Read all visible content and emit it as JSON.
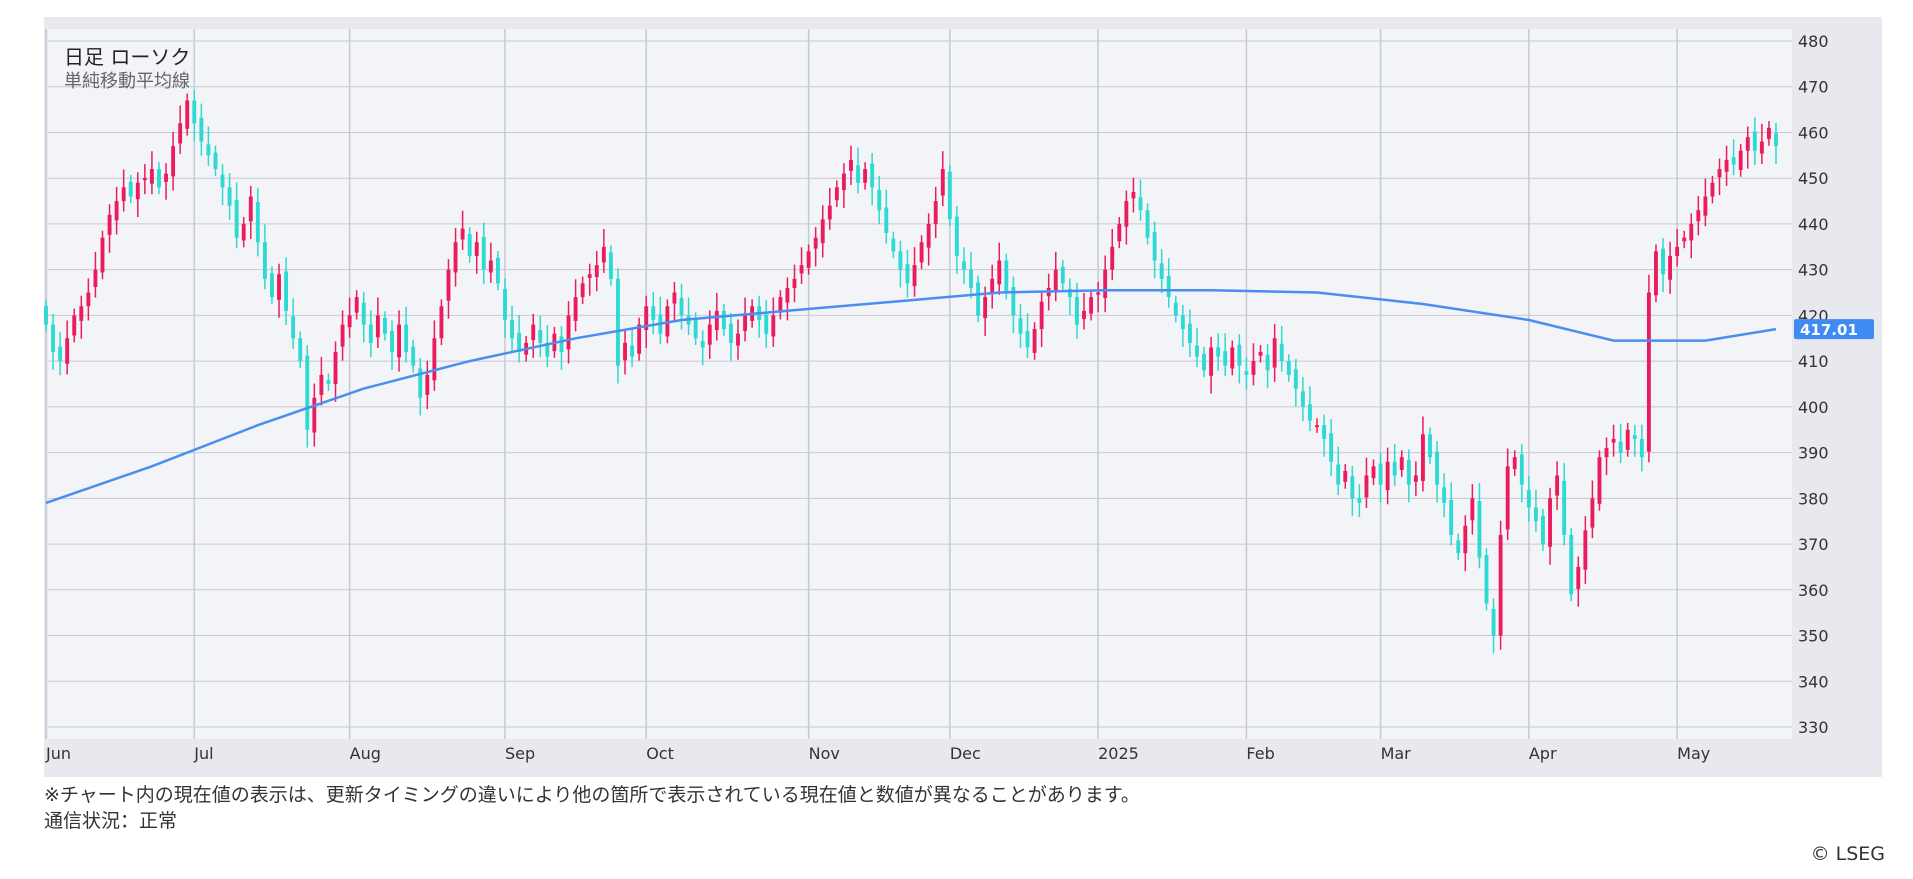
{
  "legend": {
    "title": "日足 ローソク",
    "subtitle": "単純移動平均線"
  },
  "footer": {
    "note": "※チャート内の現在値の表示は、更新タイミングの違いにより他の箇所で表示されている現在値と数値が異なることがあります。",
    "status": "通信状況：正常",
    "credit": "© LSEG"
  },
  "colors": {
    "up": "#ea1c5e",
    "down": "#2ed9d3",
    "ma": "#4a8ff0",
    "tag": "#3d8bf3",
    "panel": "#e8e9ee",
    "plot": "#f3f4f7",
    "grid": "#c6c8d4"
  },
  "chart_data": {
    "type": "candlestick",
    "title": "日足 ローソク",
    "ylim": [
      330,
      480
    ],
    "yticks": [
      "330",
      "340",
      "350",
      "360",
      "370",
      "380",
      "390",
      "400",
      "410",
      "420",
      "430",
      "440",
      "450",
      "460",
      "470",
      "480"
    ],
    "xticks": [
      {
        "label": "Jun",
        "day": 0
      },
      {
        "label": "Jul",
        "day": 21
      },
      {
        "label": "Aug",
        "day": 43
      },
      {
        "label": "Sep",
        "day": 65
      },
      {
        "label": "Oct",
        "day": 85
      },
      {
        "label": "Nov",
        "day": 108
      },
      {
        "label": "Dec",
        "day": 128
      },
      {
        "label": "2025",
        "day": 149
      },
      {
        "label": "Feb",
        "day": 170
      },
      {
        "label": "Mar",
        "day": 189
      },
      {
        "label": "Apr",
        "day": 210
      },
      {
        "label": "May",
        "day": 231
      }
    ],
    "close_path": [
      [
        0,
        418
      ],
      [
        1,
        412
      ],
      [
        2,
        410
      ],
      [
        3,
        415
      ],
      [
        4,
        420
      ],
      [
        5,
        422
      ],
      [
        6,
        425
      ],
      [
        7,
        430
      ],
      [
        8,
        437
      ],
      [
        9,
        442
      ],
      [
        10,
        445
      ],
      [
        11,
        448
      ],
      [
        12,
        446
      ],
      [
        13,
        449
      ],
      [
        14,
        450
      ],
      [
        15,
        452
      ],
      [
        16,
        448
      ],
      [
        17,
        451
      ],
      [
        18,
        457
      ],
      [
        19,
        462
      ],
      [
        20,
        467
      ],
      [
        21,
        462
      ],
      [
        22,
        458
      ],
      [
        23,
        455
      ],
      [
        24,
        452
      ],
      [
        25,
        448
      ],
      [
        26,
        444
      ],
      [
        27,
        437
      ],
      [
        28,
        440
      ],
      [
        29,
        446
      ],
      [
        30,
        436
      ],
      [
        31,
        428
      ],
      [
        32,
        424
      ],
      [
        33,
        429
      ],
      [
        34,
        421
      ],
      [
        35,
        415
      ],
      [
        36,
        410
      ],
      [
        37,
        395
      ],
      [
        38,
        402
      ],
      [
        39,
        407
      ],
      [
        40,
        405
      ],
      [
        41,
        412
      ],
      [
        42,
        418
      ],
      [
        43,
        420
      ],
      [
        44,
        424
      ],
      [
        45,
        418
      ],
      [
        46,
        414
      ],
      [
        47,
        420
      ],
      [
        48,
        416
      ],
      [
        49,
        412
      ],
      [
        50,
        418
      ],
      [
        51,
        412
      ],
      [
        52,
        409
      ],
      [
        53,
        402
      ],
      [
        54,
        407
      ],
      [
        55,
        415
      ],
      [
        56,
        422
      ],
      [
        57,
        430
      ],
      [
        58,
        436
      ],
      [
        59,
        439
      ],
      [
        60,
        433
      ],
      [
        61,
        436
      ],
      [
        62,
        430
      ],
      [
        63,
        432
      ],
      [
        64,
        427
      ],
      [
        65,
        419
      ],
      [
        66,
        415
      ],
      [
        67,
        412
      ],
      [
        68,
        414
      ],
      [
        69,
        418
      ],
      [
        70,
        414
      ],
      [
        71,
        411
      ],
      [
        72,
        416
      ],
      [
        73,
        412
      ],
      [
        74,
        420
      ],
      [
        75,
        424
      ],
      [
        76,
        427
      ],
      [
        77,
        429
      ],
      [
        78,
        431
      ],
      [
        79,
        435
      ],
      [
        80,
        428
      ],
      [
        81,
        409
      ],
      [
        82,
        414
      ],
      [
        83,
        411
      ],
      [
        84,
        418
      ],
      [
        85,
        422
      ],
      [
        86,
        419
      ],
      [
        87,
        416
      ],
      [
        88,
        422
      ],
      [
        89,
        425
      ],
      [
        90,
        420
      ],
      [
        91,
        418
      ],
      [
        92,
        415
      ],
      [
        93,
        413
      ],
      [
        94,
        418
      ],
      [
        95,
        421
      ],
      [
        96,
        417
      ],
      [
        97,
        414
      ],
      [
        98,
        416
      ],
      [
        99,
        420
      ],
      [
        100,
        422
      ],
      [
        101,
        419
      ],
      [
        102,
        416
      ],
      [
        103,
        420
      ],
      [
        104,
        424
      ],
      [
        105,
        426
      ],
      [
        106,
        428
      ],
      [
        107,
        431
      ],
      [
        108,
        434
      ],
      [
        109,
        437
      ],
      [
        110,
        441
      ],
      [
        111,
        444
      ],
      [
        112,
        448
      ],
      [
        113,
        451
      ],
      [
        114,
        454
      ],
      [
        115,
        449
      ],
      [
        116,
        452
      ],
      [
        117,
        448
      ],
      [
        118,
        443
      ],
      [
        119,
        438
      ],
      [
        120,
        434
      ],
      [
        121,
        430
      ],
      [
        122,
        427
      ],
      [
        123,
        431
      ],
      [
        124,
        436
      ],
      [
        125,
        440
      ],
      [
        126,
        445
      ],
      [
        127,
        452
      ],
      [
        128,
        441
      ],
      [
        129,
        433
      ],
      [
        130,
        430
      ],
      [
        131,
        426
      ],
      [
        132,
        420
      ],
      [
        133,
        424
      ],
      [
        134,
        428
      ],
      [
        135,
        432
      ],
      [
        136,
        425
      ],
      [
        137,
        420
      ],
      [
        138,
        416
      ],
      [
        139,
        413
      ],
      [
        140,
        417
      ],
      [
        141,
        423
      ],
      [
        142,
        426
      ],
      [
        143,
        430
      ],
      [
        144,
        427
      ],
      [
        145,
        424
      ],
      [
        146,
        418
      ],
      [
        147,
        421
      ],
      [
        148,
        424
      ],
      [
        149,
        425
      ],
      [
        150,
        430
      ],
      [
        151,
        435
      ],
      [
        152,
        440
      ],
      [
        153,
        445
      ],
      [
        154,
        447
      ],
      [
        155,
        443
      ],
      [
        156,
        437
      ],
      [
        157,
        432
      ],
      [
        158,
        428
      ],
      [
        159,
        424
      ],
      [
        160,
        420
      ],
      [
        161,
        417
      ],
      [
        162,
        414
      ],
      [
        163,
        411
      ],
      [
        164,
        408
      ],
      [
        165,
        413
      ],
      [
        166,
        411
      ],
      [
        167,
        409
      ],
      [
        168,
        413
      ],
      [
        169,
        409
      ],
      [
        170,
        407
      ],
      [
        171,
        410
      ],
      [
        172,
        412
      ],
      [
        173,
        408
      ],
      [
        174,
        415
      ],
      [
        175,
        410
      ],
      [
        176,
        407
      ],
      [
        177,
        404
      ],
      [
        178,
        400
      ],
      [
        179,
        397
      ],
      [
        180,
        396
      ],
      [
        181,
        393
      ],
      [
        182,
        388
      ],
      [
        183,
        383
      ],
      [
        184,
        386
      ],
      [
        185,
        380
      ],
      [
        186,
        379
      ],
      [
        187,
        385
      ],
      [
        188,
        387
      ],
      [
        189,
        383
      ],
      [
        190,
        388
      ],
      [
        191,
        385
      ],
      [
        192,
        389
      ],
      [
        193,
        383
      ],
      [
        194,
        385
      ],
      [
        195,
        394
      ],
      [
        196,
        389
      ],
      [
        197,
        383
      ],
      [
        198,
        379
      ],
      [
        199,
        372
      ],
      [
        200,
        368
      ],
      [
        201,
        374
      ],
      [
        202,
        380
      ],
      [
        203,
        367
      ],
      [
        204,
        357
      ],
      [
        205,
        350
      ],
      [
        206,
        372
      ],
      [
        207,
        387
      ],
      [
        208,
        389
      ],
      [
        209,
        383
      ],
      [
        210,
        378
      ],
      [
        211,
        375
      ],
      [
        212,
        370
      ],
      [
        213,
        380
      ],
      [
        214,
        385
      ],
      [
        215,
        372
      ],
      [
        216,
        359
      ],
      [
        217,
        365
      ],
      [
        218,
        373
      ],
      [
        219,
        380
      ],
      [
        220,
        389
      ],
      [
        221,
        391
      ],
      [
        222,
        393
      ],
      [
        223,
        390
      ],
      [
        224,
        395
      ],
      [
        225,
        393
      ],
      [
        226,
        389
      ],
      [
        227,
        425
      ],
      [
        228,
        434
      ],
      [
        229,
        429
      ],
      [
        230,
        433
      ],
      [
        231,
        435
      ],
      [
        232,
        437
      ],
      [
        233,
        440
      ],
      [
        234,
        443
      ],
      [
        235,
        446
      ],
      [
        236,
        449
      ],
      [
        237,
        452
      ],
      [
        238,
        454
      ],
      [
        239,
        453
      ],
      [
        240,
        456
      ],
      [
        241,
        459
      ],
      [
        242,
        456
      ],
      [
        243,
        458
      ],
      [
        244,
        461
      ],
      [
        245,
        457
      ]
    ],
    "ma_path": [
      [
        0,
        379
      ],
      [
        15,
        387
      ],
      [
        30,
        396
      ],
      [
        45,
        404
      ],
      [
        60,
        410
      ],
      [
        75,
        415
      ],
      [
        90,
        419
      ],
      [
        105,
        421
      ],
      [
        120,
        423
      ],
      [
        135,
        425
      ],
      [
        150,
        425.5
      ],
      [
        165,
        425.5
      ],
      [
        180,
        425
      ],
      [
        195,
        422.5
      ],
      [
        210,
        419
      ],
      [
        222,
        414.5
      ],
      [
        235,
        414.5
      ],
      [
        245,
        417
      ]
    ],
    "current_value": "417.01",
    "series": [
      {
        "name": "日足 ローソク",
        "kind": "candles"
      },
      {
        "name": "単純移動平均線",
        "kind": "line",
        "last": 417.01
      }
    ]
  }
}
